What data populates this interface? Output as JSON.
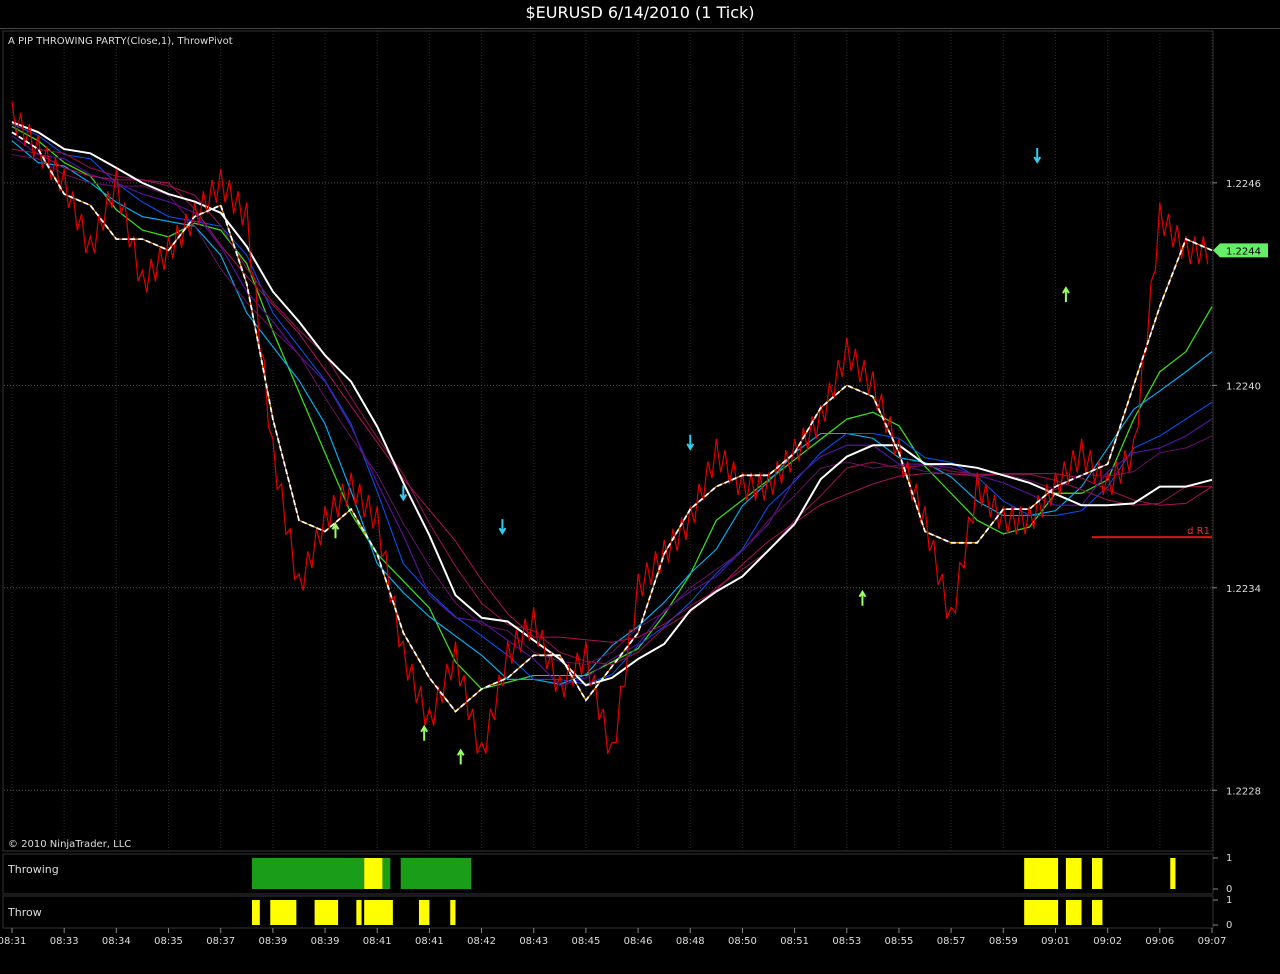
{
  "window": {
    "title": "$EURUSD  6/14/2010 (1 Tick)"
  },
  "main_panel": {
    "indicator_label": "A PIP THROWING PARTY(Close,1), ThrowPivot",
    "copyright": "© 2010 NinjaTrader, LLC",
    "price_marker": "1.2244",
    "pivot_label": "d R1",
    "background": "#000000"
  },
  "sub_panels": [
    {
      "name": "Throwing",
      "ticks": [
        "1",
        "0"
      ]
    },
    {
      "name": "Throw",
      "ticks": [
        "1",
        "0"
      ]
    }
  ],
  "colors": {
    "price_line": "#e00000",
    "signal_bar": "#ffff00",
    "throwing_bar": "#1a9e1a",
    "down_arrow": "#33ccee",
    "up_arrow": "#99ff66",
    "pivot_line": "#dd1111"
  },
  "chart_data": {
    "type": "line",
    "title": "$EURUSD  6/14/2010 (1 Tick)",
    "x_tick_labels": [
      "08:31",
      "08:33",
      "08:34",
      "08:35",
      "08:37",
      "08:39",
      "08:39",
      "08:41",
      "08:41",
      "08:42",
      "08:43",
      "08:45",
      "08:46",
      "08:48",
      "08:50",
      "08:51",
      "08:53",
      "08:55",
      "08:57",
      "08:59",
      "09:01",
      "09:02",
      "09:06",
      "09:07"
    ],
    "y_tick_labels": [
      "1.2246",
      "1.2240",
      "1.2234",
      "1.2228"
    ],
    "ylim": [
      1.22262,
      1.22505
    ],
    "grid": true,
    "price_series": {
      "name": "Close",
      "x": [
        0,
        0.5,
        1,
        1.5,
        2,
        2.5,
        3,
        3.5,
        4,
        4.5,
        5,
        5.5,
        6,
        6.5,
        7,
        7.5,
        8,
        8.5,
        9,
        9.5,
        10,
        10.5,
        11,
        11.5,
        12,
        12.5,
        13,
        13.5,
        14,
        14.5,
        15,
        15.5,
        16,
        16.5,
        17,
        17.5,
        18,
        18.5,
        19,
        19.5,
        20,
        20.5,
        21,
        21.5,
        22,
        22.5,
        23
      ],
      "y": [
        1.2248,
        1.2247,
        1.2246,
        1.2244,
        1.2246,
        1.2243,
        1.2244,
        1.2245,
        1.2246,
        1.2245,
        1.2238,
        1.2234,
        1.2236,
        1.2237,
        1.2236,
        1.2232,
        1.223,
        1.2232,
        1.2229,
        1.2232,
        1.2233,
        1.2231,
        1.2232,
        1.2229,
        1.2234,
        1.2235,
        1.2236,
        1.2238,
        1.2237,
        1.2237,
        1.2238,
        1.2239,
        1.2241,
        1.224,
        1.2238,
        1.2236,
        1.2233,
        1.2237,
        1.2236,
        1.2236,
        1.2237,
        1.2238,
        1.2237,
        1.2238,
        1.2245,
        1.2244,
        1.2244
      ]
    },
    "pivot_level": 1.22355,
    "signals_down": [
      {
        "x": 7.5,
        "y": 1.22365
      },
      {
        "x": 9.4,
        "y": 1.22355
      },
      {
        "x": 13.0,
        "y": 1.2238
      },
      {
        "x": 19.65,
        "y": 1.22465
      }
    ],
    "signals_up": [
      {
        "x": 6.2,
        "y": 1.2236
      },
      {
        "x": 7.9,
        "y": 1.223
      },
      {
        "x": 8.6,
        "y": 1.22293
      },
      {
        "x": 16.3,
        "y": 1.2234
      },
      {
        "x": 20.2,
        "y": 1.2243
      }
    ],
    "throwing_bars": [
      {
        "from": 4.6,
        "to": 6.75,
        "color": "#1a9e1a"
      },
      {
        "from": 6.75,
        "to": 7.1,
        "color": "#ffff00"
      },
      {
        "from": 7.1,
        "to": 7.25,
        "color": "#1a9e1a"
      },
      {
        "from": 7.45,
        "to": 8.8,
        "color": "#1a9e1a"
      },
      {
        "from": 19.4,
        "to": 20.05,
        "color": "#ffff00"
      },
      {
        "from": 20.2,
        "to": 20.5,
        "color": "#ffff00"
      },
      {
        "from": 20.7,
        "to": 20.9,
        "color": "#ffff00"
      },
      {
        "from": 22.2,
        "to": 22.3,
        "color": "#ffff00"
      }
    ],
    "throw_bars": [
      {
        "from": 4.6,
        "to": 4.75,
        "color": "#ffff00"
      },
      {
        "from": 4.95,
        "to": 5.45,
        "color": "#ffff00"
      },
      {
        "from": 5.8,
        "to": 6.25,
        "color": "#ffff00"
      },
      {
        "from": 6.6,
        "to": 6.7,
        "color": "#ffff00"
      },
      {
        "from": 6.75,
        "to": 7.3,
        "color": "#ffff00"
      },
      {
        "from": 7.8,
        "to": 8.0,
        "color": "#ffff00"
      },
      {
        "from": 8.4,
        "to": 8.5,
        "color": "#ffff00"
      },
      {
        "from": 19.4,
        "to": 20.05,
        "color": "#ffff00"
      },
      {
        "from": 20.2,
        "to": 20.5,
        "color": "#ffff00"
      },
      {
        "from": 20.7,
        "to": 20.9,
        "color": "#ffff00"
      }
    ]
  }
}
